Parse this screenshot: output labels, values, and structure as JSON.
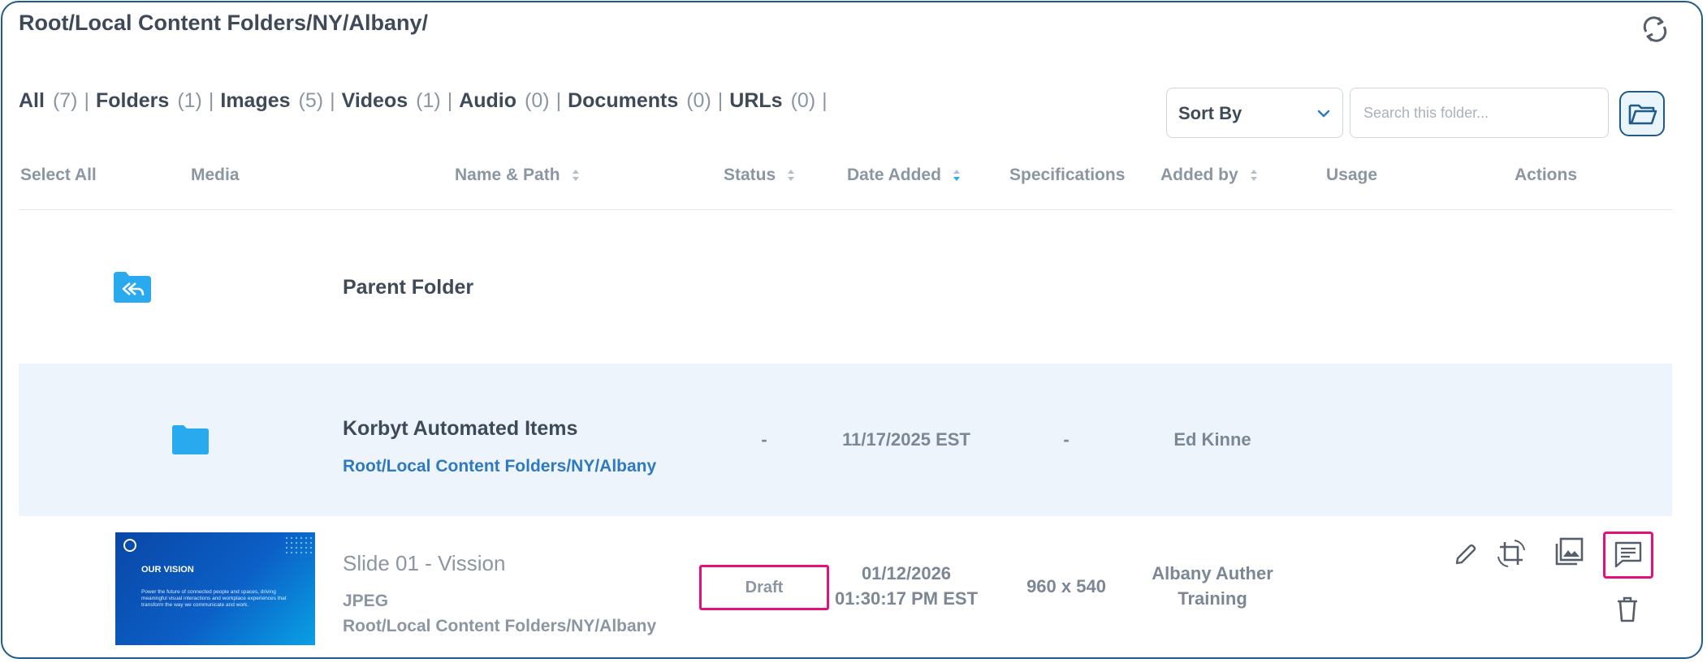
{
  "breadcrumb": "Root/Local Content Folders/NY/Albany/",
  "filters": [
    {
      "label": "All",
      "count": "(7)"
    },
    {
      "label": "Folders",
      "count": "(1)"
    },
    {
      "label": "Images",
      "count": "(5)"
    },
    {
      "label": "Videos",
      "count": "(1)"
    },
    {
      "label": "Audio",
      "count": "(0)"
    },
    {
      "label": "Documents",
      "count": "(0)"
    },
    {
      "label": "URLs",
      "count": "(0)"
    }
  ],
  "filter_separator": "|",
  "sort": {
    "label": "Sort By"
  },
  "search": {
    "placeholder": "Search this folder..."
  },
  "columns": {
    "select_all": "Select All",
    "media": "Media",
    "name_path": "Name & Path",
    "status": "Status",
    "date_added": "Date Added",
    "specifications": "Specifications",
    "added_by": "Added by",
    "usage": "Usage",
    "actions": "Actions"
  },
  "parent_row": {
    "label": "Parent Folder"
  },
  "folder_row": {
    "name": "Korbyt Automated Items",
    "path": "Root/Local Content Folders/NY/Albany",
    "status": "-",
    "date": "11/17/2025 EST",
    "specs": "-",
    "added_by": "Ed Kinne"
  },
  "item_row": {
    "name": "Slide 01 - Vission",
    "type": "JPEG",
    "path": "Root/Local Content Folders/NY/Albany",
    "status": "Draft",
    "date": "01/12/2026",
    "time": "01:30:17 PM EST",
    "specs": "960 x 540",
    "added_by_line1": "Albany Auther",
    "added_by_line2": "Training",
    "thumb_title": "OUR VISION",
    "thumb_text": "Power the future of connected people and spaces, driving meaningful visual interactions and workplace experiences that transform the way we communicate and work."
  },
  "colors": {
    "accent_blue": "#2e79c0",
    "folder_blue": "#29a9ee",
    "highlight_pink": "#e4117d",
    "row_highlight": "#eef4fb"
  }
}
